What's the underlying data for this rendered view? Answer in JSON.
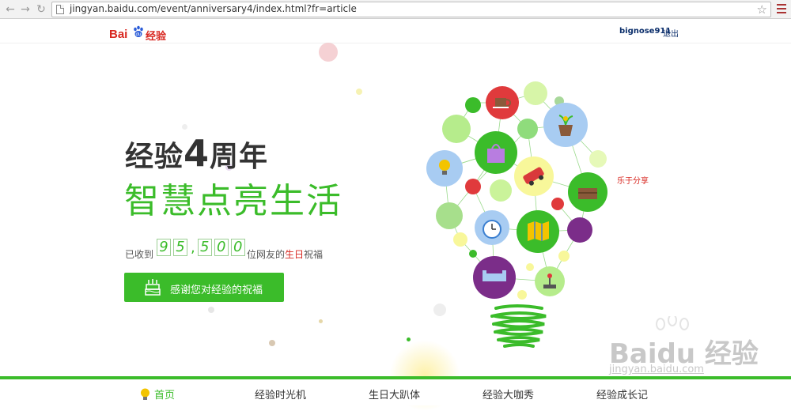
{
  "browser": {
    "url": "jingyan.baidu.com/event/anniversary4/index.html?fr=article",
    "back_icon": "←",
    "forward_icon": "→",
    "reload_icon": "↻",
    "star_icon": "☆"
  },
  "header": {
    "logo_bai": "Bai",
    "logo_jy": "经验",
    "username": "bignose911",
    "logout": "退出"
  },
  "hero": {
    "title_a": "经验",
    "title_num": "4",
    "title_b": "周年",
    "subtitle": "智慧点亮生活",
    "counter_pre": "已收到",
    "counter_digits": [
      "9",
      "5",
      ",",
      "5",
      "0",
      "0"
    ],
    "counter_post_a": "位网友的",
    "counter_post_hl": "生日",
    "counter_post_b": "祝福",
    "bless_button": "感谢您对经验的祝福"
  },
  "share_label": "乐于分享",
  "watermark": {
    "text": "Baidu 经验",
    "sub": "jingyan.baidu.com"
  },
  "bottom_nav": {
    "items": [
      {
        "label": "首页"
      },
      {
        "label": "经验时光机"
      },
      {
        "label": "生日大趴体"
      },
      {
        "label": "经验大咖秀"
      },
      {
        "label": "经验成长记"
      }
    ]
  },
  "colors": {
    "brand_green": "#3bbc2a",
    "brand_red": "#d8261f"
  }
}
